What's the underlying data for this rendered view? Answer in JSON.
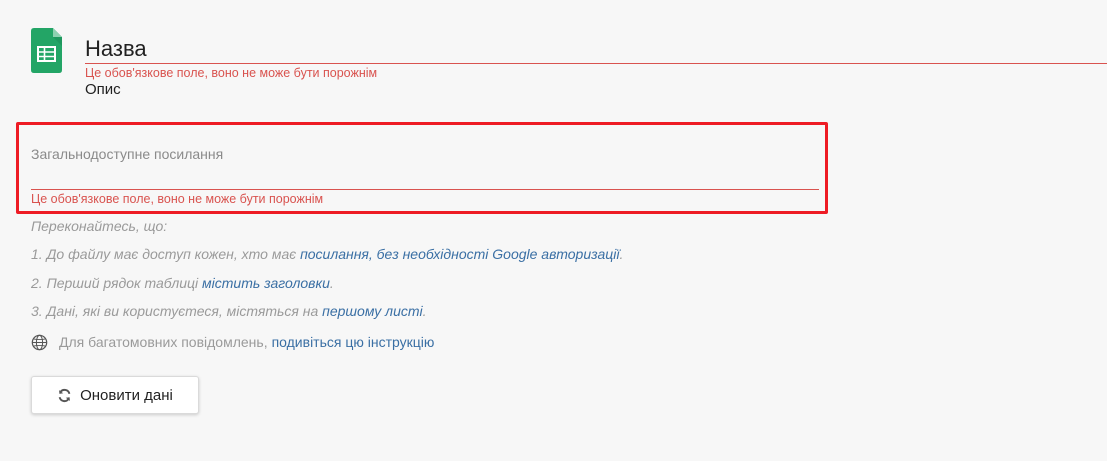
{
  "header": {
    "icon": "google-sheets-icon",
    "title_value": "Назва",
    "title_error": "Це обов'язкове поле, воно не може бути порожнім",
    "description_placeholder": "Опис"
  },
  "public_link": {
    "label": "Загальнодоступне посилання",
    "value": "",
    "error": "Це обов'язкове поле, воно не може бути порожнім"
  },
  "hints": {
    "intro": "Переконайтесь, що:",
    "item1_text": "1. До файлу має доступ кожен, хто має ",
    "item1_link": "посилання, без необхідності Google авторизації",
    "item1_end": ".",
    "item2_text": "2. Перший рядок таблиці ",
    "item2_link": "містить заголовки",
    "item2_end": ".",
    "item3_text": "3. Дані, які ви користуєтеся, містяться на ",
    "item3_link": "першому листі",
    "item3_end": "."
  },
  "multilang": {
    "icon": "globe-icon",
    "text": "Для багатомовних повідомлень,",
    "link": "подивіться цю інструкцію"
  },
  "refresh_button": {
    "icon": "refresh-icon",
    "label": "Оновити дані"
  },
  "colors": {
    "error": "#d9534f",
    "highlight": "#ee1c25",
    "link": "#3a6fa4",
    "sheets_green": "#23a566"
  }
}
